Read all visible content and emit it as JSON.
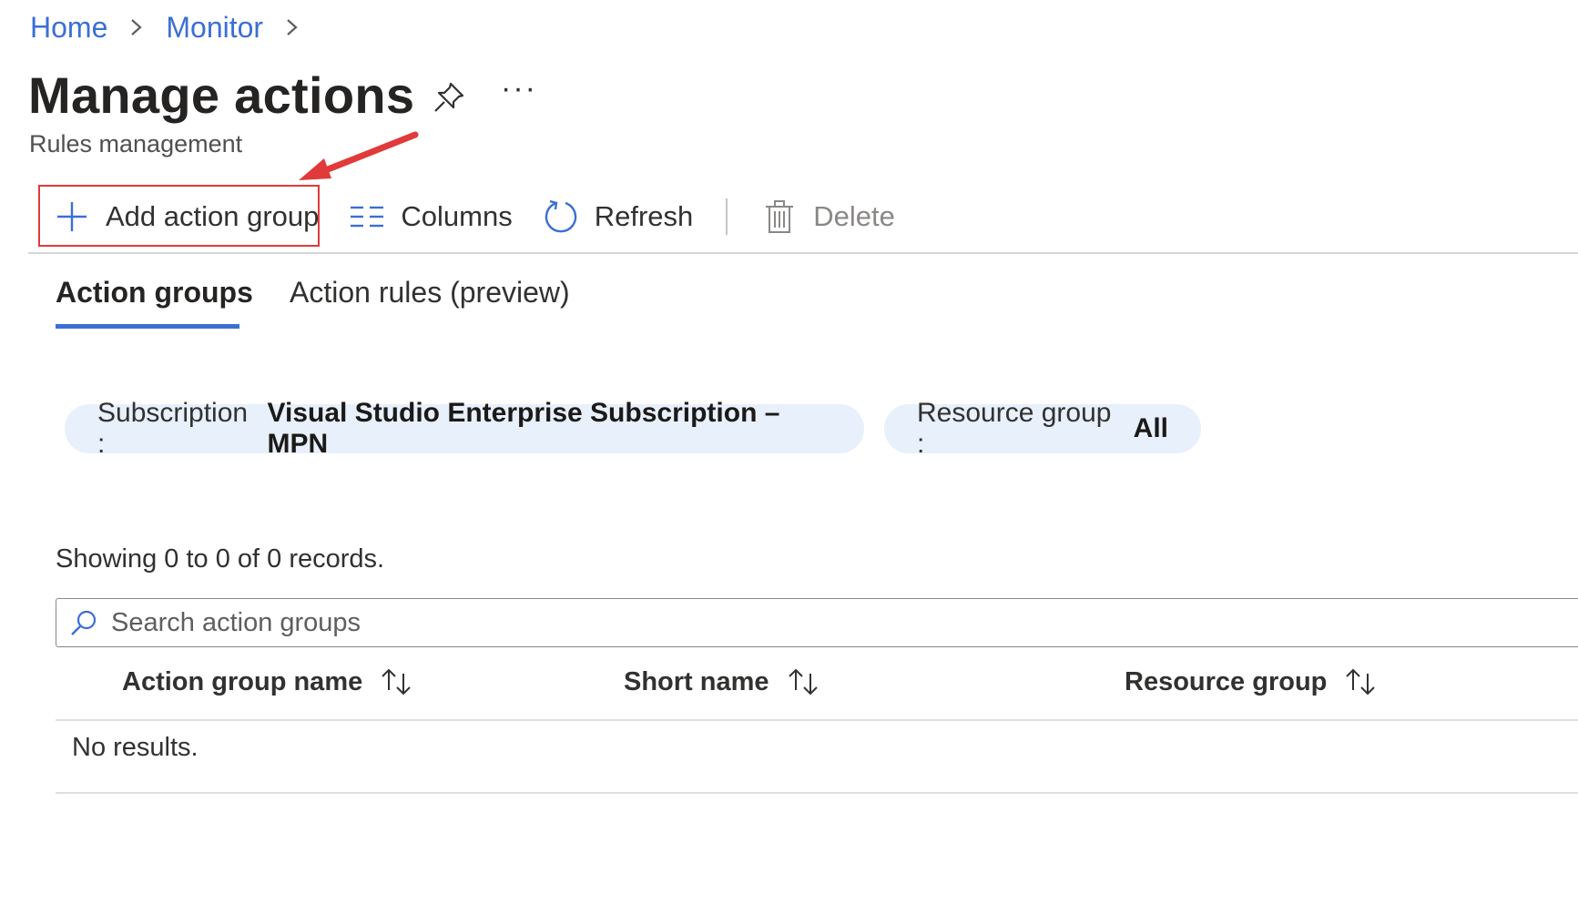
{
  "breadcrumb": {
    "home": "Home",
    "monitor": "Monitor"
  },
  "header": {
    "title": "Manage actions",
    "subtitle": "Rules management",
    "more": "···"
  },
  "toolbar": {
    "add_label": "Add action group",
    "columns_label": "Columns",
    "refresh_label": "Refresh",
    "delete_label": "Delete"
  },
  "tabs": [
    {
      "label": "Action groups",
      "active": true
    },
    {
      "label": "Action rules (preview)",
      "active": false
    }
  ],
  "filters": {
    "subscription_key": "Subscription :",
    "subscription_value": "Visual Studio Enterprise Subscription – MPN",
    "resource_group_key": "Resource group :",
    "resource_group_value": "All"
  },
  "records_text": "Showing 0 to 0 of 0 records.",
  "search": {
    "placeholder": "Search action groups",
    "value": ""
  },
  "table": {
    "columns": [
      "Action group name",
      "Short name",
      "Resource group"
    ],
    "empty_text": "No results."
  },
  "colors": {
    "accent": "#3b6fd4",
    "highlight": "#e03a3a",
    "pill_bg": "#e8f0fb"
  },
  "icons": [
    "chevron-right-icon",
    "pin-icon",
    "plus-icon",
    "columns-icon",
    "refresh-icon",
    "trash-icon",
    "search-icon",
    "sort-icon"
  ]
}
